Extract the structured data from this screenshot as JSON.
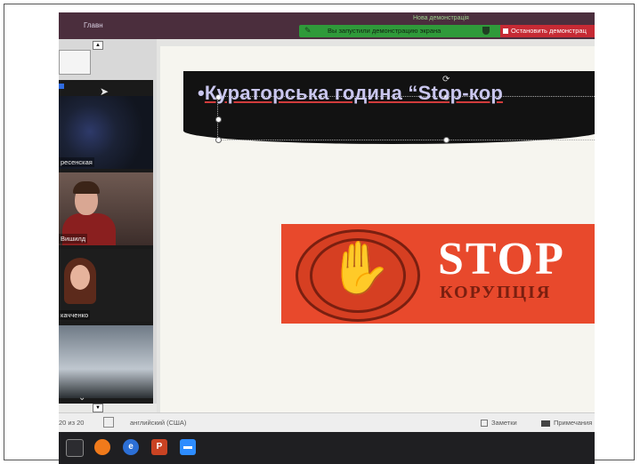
{
  "topbar": {
    "tab_home": "Главн",
    "share_title": "Нова демонстрація",
    "share_message": "Вы запустили демонстрацию экрана",
    "stop_share_label": "Остановить демонстрац"
  },
  "gallery": {
    "participants": [
      {
        "name": "ресенская"
      },
      {
        "name": "Вишилд"
      },
      {
        "name": "качченко"
      },
      {
        "name": ""
      }
    ]
  },
  "slide": {
    "title": "Кураторська година “Stop-кор",
    "stop_word": "STOP",
    "stop_sub": "КОРУПЦІЯ"
  },
  "statusbar": {
    "pages": "20 из 20",
    "language": "английский (США)",
    "notes": "Заметки",
    "comments": "Примечания"
  },
  "taskbar": {
    "edge_letter": "e",
    "ppt_letter": "P"
  },
  "colors": {
    "share_green": "#2f9a3a",
    "stop_red": "#c62a34",
    "banner_black": "#121212",
    "stop_orange": "#e8492c"
  },
  "icons": [
    "pen-icon",
    "shield-icon",
    "stop-square-icon",
    "cursor-icon",
    "rotate-icon",
    "hand-icon",
    "task-view-icon",
    "firefox-icon",
    "edge-icon",
    "powerpoint-icon",
    "zoom-icon",
    "notes-icon",
    "comments-icon"
  ]
}
